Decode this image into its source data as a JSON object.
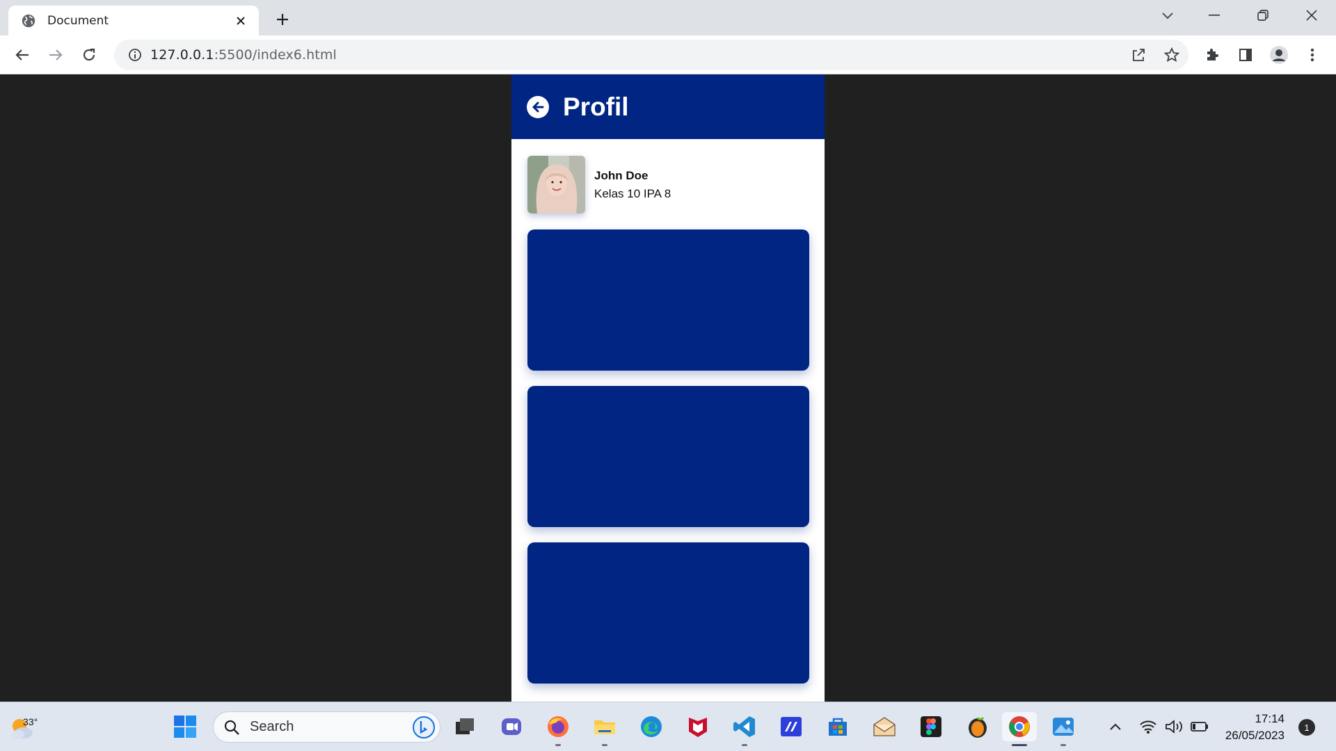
{
  "browser": {
    "tab_title": "Document",
    "url_host": "127.0.0.1",
    "url_path": ":5500/index6.html"
  },
  "app": {
    "header_title": "Profil",
    "profile": {
      "name": "John Doe",
      "class": "Kelas 10 IPA 8"
    },
    "cards_count": 3,
    "brand_color": "#002583"
  },
  "taskbar": {
    "weather_temp": "33°",
    "search_label": "Search",
    "time": "17:14",
    "date": "26/05/2023",
    "notification_count": "1",
    "pinned_icons": [
      "file-explorer-icon",
      "teams-icon",
      "firefox-icon",
      "folder-icon",
      "edge-icon",
      "mcafee-icon",
      "vscode-icon",
      "visual-studio-icon",
      "microsoft-store-icon",
      "email-icon",
      "figma-icon",
      "fl-studio-icon",
      "chrome-icon",
      "photos-icon"
    ]
  }
}
